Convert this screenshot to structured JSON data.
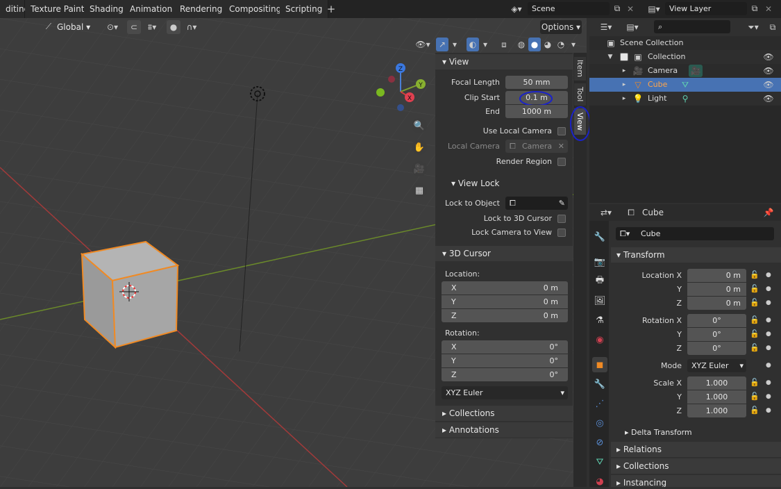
{
  "workspace_tabs": [
    "diting",
    "Texture Paint",
    "Shading",
    "Animation",
    "Rendering",
    "Compositing",
    "Scripting"
  ],
  "scene": {
    "label": "Scene"
  },
  "view_layer": {
    "label": "View Layer"
  },
  "viewport_header": {
    "orientation": "Global",
    "options": "Options"
  },
  "nav_axes": {
    "z": "Z",
    "y": "Y",
    "x": "X"
  },
  "npanel_tabs": [
    "Item",
    "Tool",
    "View"
  ],
  "view_panel": {
    "title": "View",
    "focal_length_label": "Focal Length",
    "focal_length": "50 mm",
    "clip_start_label": "Clip Start",
    "clip_start": "0.1 m",
    "end_label": "End",
    "end": "1000 m",
    "use_local_camera": "Use Local Camera",
    "local_camera_label": "Local Camera",
    "local_camera": "Camera",
    "render_region": "Render Region"
  },
  "view_lock": {
    "title": "View Lock",
    "lock_to_object": "Lock to Object",
    "lock_to_3d_cursor": "Lock to 3D Cursor",
    "lock_camera_to_view": "Lock Camera to View"
  },
  "cursor_panel": {
    "title": "3D Cursor",
    "location_label": "Location:",
    "location": [
      {
        "axis": "X",
        "value": "0 m"
      },
      {
        "axis": "Y",
        "value": "0 m"
      },
      {
        "axis": "Z",
        "value": "0 m"
      }
    ],
    "rotation_label": "Rotation:",
    "rotation": [
      {
        "axis": "X",
        "value": "0°"
      },
      {
        "axis": "Y",
        "value": "0°"
      },
      {
        "axis": "Z",
        "value": "0°"
      }
    ],
    "rotation_mode": "XYZ Euler"
  },
  "npanel_collapsed": [
    "Collections",
    "Annotations"
  ],
  "outliner": {
    "scene_collection": "Scene Collection",
    "collection": "Collection",
    "items": [
      "Camera",
      "Cube",
      "Light"
    ]
  },
  "properties": {
    "object_name_header": "Cube",
    "object_name": "Cube",
    "transform_title": "Transform",
    "location": [
      {
        "label": "Location X",
        "value": "0 m"
      },
      {
        "label": "Y",
        "value": "0 m"
      },
      {
        "label": "Z",
        "value": "0 m"
      }
    ],
    "rotation": [
      {
        "label": "Rotation X",
        "value": "0°"
      },
      {
        "label": "Y",
        "value": "0°"
      },
      {
        "label": "Z",
        "value": "0°"
      }
    ],
    "mode_label": "Mode",
    "mode": "XYZ Euler",
    "scale": [
      {
        "label": "Scale X",
        "value": "1.000"
      },
      {
        "label": "Y",
        "value": "1.000"
      },
      {
        "label": "Z",
        "value": "1.000"
      }
    ],
    "delta_transform": "Delta Transform",
    "sections": [
      "Relations",
      "Collections",
      "Instancing"
    ]
  },
  "colors": {
    "selected_orange": "#f08a24",
    "selection_blue": "#4772b3",
    "annotation_blue": "#1a22c8"
  }
}
